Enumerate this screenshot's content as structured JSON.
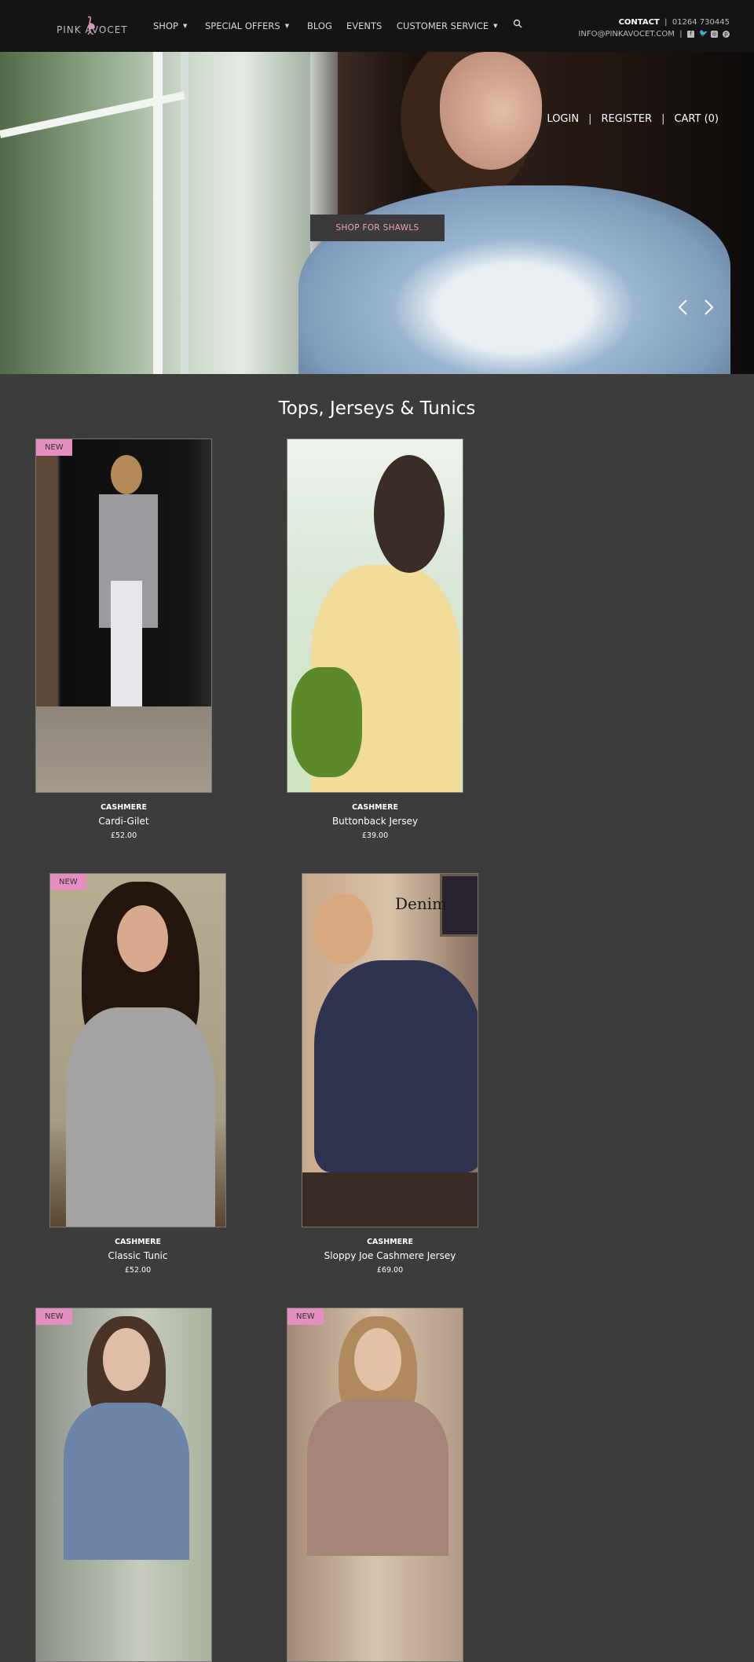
{
  "brand": {
    "logo_text": "PINK AVOCET",
    "accent": "#e48fbf"
  },
  "nav": {
    "items": [
      {
        "label": "SHOP",
        "dropdown": true
      },
      {
        "label": "SPECIAL OFFERS",
        "dropdown": true
      },
      {
        "label": "BLOG"
      },
      {
        "label": "EVENTS"
      },
      {
        "label": "CUSTOMER SERVICE",
        "dropdown": true
      }
    ],
    "search_icon": "search-icon"
  },
  "contact": {
    "label": "CONTACT",
    "phone": "01264 730445",
    "email": "INFO@PINKAVOCET.COM",
    "social": [
      "facebook-icon",
      "twitter-icon",
      "instagram-icon",
      "pinterest-icon"
    ]
  },
  "account": {
    "login": "LOGIN",
    "register": "REGISTER",
    "cart": "CART (0)"
  },
  "hero": {
    "cta": "SHOP FOR SHAWLS",
    "prev": "‹",
    "next": "›"
  },
  "collection": {
    "title": "Tops, Jerseys & Tunics",
    "badge": "NEW",
    "products": [
      {
        "category": "CASHMERE",
        "name": "Cardi-Gilet",
        "price": "£52.00",
        "new": true
      },
      {
        "category": "CASHMERE",
        "name": "Buttonback Jersey",
        "price": "£39.00",
        "new": false
      },
      {
        "category": "CASHMERE",
        "name": "Classic Tunic",
        "price": "£52.00",
        "new": true
      },
      {
        "category": "CASHMERE",
        "name": "Sloppy Joe Cashmere Jersey",
        "price": "£69.00",
        "new": false,
        "image_text": "Denim"
      },
      {
        "new": true
      },
      {
        "new": true
      }
    ]
  }
}
